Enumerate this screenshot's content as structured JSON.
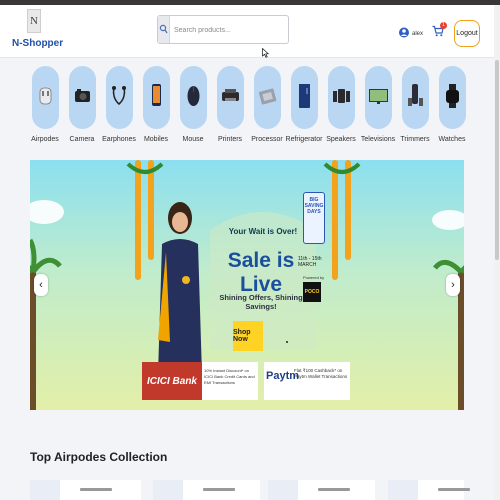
{
  "header": {
    "logo_letter": "N",
    "brand": "N-Shopper",
    "search": {
      "placeholder": "Search products..."
    },
    "user_name": "alex",
    "cart_count": "1",
    "logout_label": "Logout"
  },
  "categories": [
    {
      "label": "Airpodes",
      "icon": "airpods-icon"
    },
    {
      "label": "Camera",
      "icon": "camera-icon"
    },
    {
      "label": "Earphones",
      "icon": "earphones-icon"
    },
    {
      "label": "Mobiles",
      "icon": "mobile-icon"
    },
    {
      "label": "Mouse",
      "icon": "mouse-icon"
    },
    {
      "label": "Printers",
      "icon": "printer-icon"
    },
    {
      "label": "Processor",
      "icon": "processor-icon"
    },
    {
      "label": "Refrigerator",
      "icon": "refrigerator-icon"
    },
    {
      "label": "Speakers",
      "icon": "speaker-icon"
    },
    {
      "label": "Televisions",
      "icon": "television-icon"
    },
    {
      "label": "Trimmers",
      "icon": "trimmer-icon"
    },
    {
      "label": "Watches",
      "icon": "watch-icon"
    }
  ],
  "banner": {
    "headline_small": "Your Wait is Over!",
    "headline": "Sale is Live",
    "tagline": "Shining Offers, Shining Savings!",
    "cta": "Shop Now",
    "badge": "BIG SAVING DAYS",
    "dates": "11th - 15th MARCH",
    "powered_by": "Powered by",
    "sponsor": "POCO",
    "bank": "ICICI Bank",
    "bank_offer": "10% Instant Discount* on ICICI Bank Credit Cards and EMI Transactions",
    "wallet": "Paytm",
    "wallet_offer": "Flat ₹100 Cashback* on Paytm Wallet Transactions"
  },
  "section": {
    "title": "Top Airpodes Collection"
  },
  "colors": {
    "brand": "#1f4fa8",
    "category_bg": "#b9d6f2",
    "logout_border": "#f0a01a",
    "cart_badge": "#e8412c",
    "cta": "#ffd324"
  }
}
